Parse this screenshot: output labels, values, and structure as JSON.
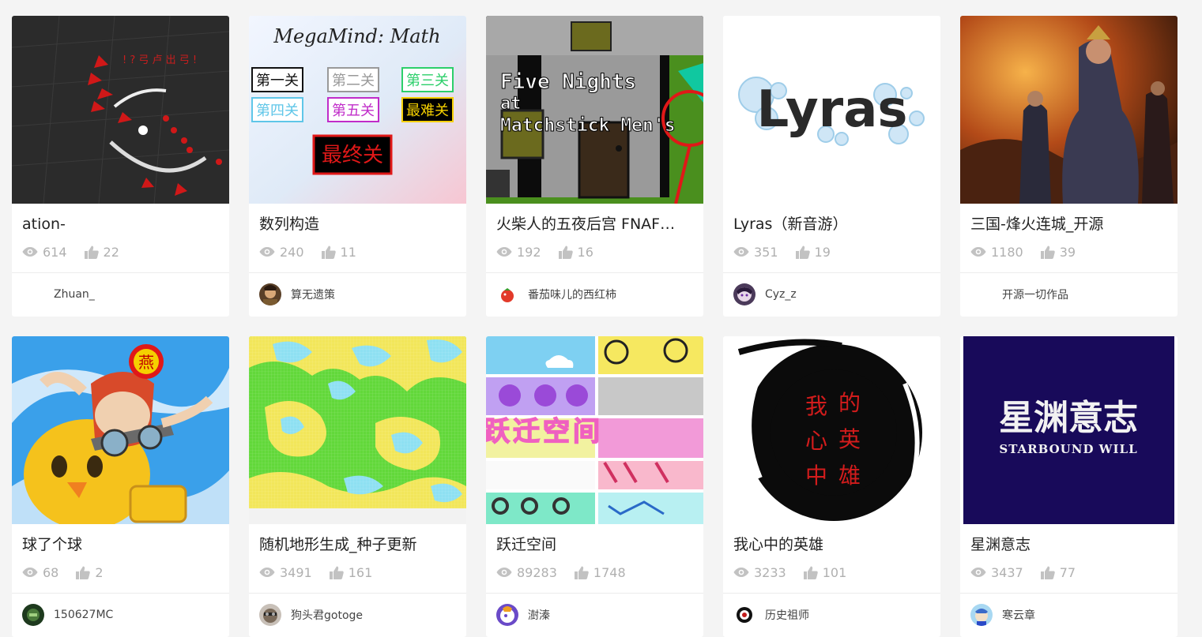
{
  "cards": [
    {
      "title": "ation-",
      "views": "614",
      "likes": "22",
      "author": "Zhuan_",
      "thumb": "dark-arena",
      "avatar": "none"
    },
    {
      "title": "数列构造",
      "views": "240",
      "likes": "11",
      "author": "算无遗策",
      "thumb": "megamind-math",
      "avatar": "warrior",
      "thumb_text": {
        "heading": "MegaMind: Math",
        "levels": [
          "第一关",
          "第二关",
          "第三关",
          "第四关",
          "第五关",
          "最难关"
        ],
        "final": "最终关"
      }
    },
    {
      "title": "火柴人的五夜后宫 FNAF…",
      "views": "192",
      "likes": "16",
      "author": "番茄味儿的西红柿",
      "thumb": "fnaf",
      "avatar": "tomato",
      "thumb_text": {
        "line1": "Five Nights",
        "line2": "at",
        "line3": "Matchstick Men's"
      }
    },
    {
      "title": "Lyras（新音游）",
      "views": "351",
      "likes": "19",
      "author": "Cyz_z",
      "thumb": "lyras",
      "avatar": "anime",
      "thumb_text": {
        "logo": "Lyras"
      }
    },
    {
      "title": "三国-烽火连城_开源",
      "views": "1180",
      "likes": "39",
      "author": "开源一切作品",
      "thumb": "three-kingdoms",
      "avatar": "none"
    },
    {
      "title": "球了个球",
      "views": "68",
      "likes": "2",
      "author": "150627MC",
      "thumb": "ball-hero",
      "avatar": "dark-green",
      "thumb_text": {
        "badge": "燕"
      }
    },
    {
      "title": "随机地形生成_种子更新",
      "views": "3491",
      "likes": "161",
      "author": "狗头君gotoge",
      "thumb": "terrain",
      "avatar": "dog"
    },
    {
      "title": "跃迁空间",
      "views": "89283",
      "likes": "1748",
      "author": "澍溱",
      "thumb": "leap-space",
      "avatar": "purple",
      "thumb_text": {
        "logo": "跃迁空间"
      }
    },
    {
      "title": "我心中的英雄",
      "views": "3233",
      "likes": "101",
      "author": "历史祖师",
      "thumb": "ink-hero",
      "avatar": "ink",
      "thumb_text": {
        "col1": [
          "我",
          "心",
          "中"
        ],
        "col2": [
          "的",
          "英",
          "雄"
        ]
      }
    },
    {
      "title": "星渊意志",
      "views": "3437",
      "likes": "77",
      "author": "寒云章",
      "thumb": "starbound",
      "avatar": "blue-character",
      "thumb_text": {
        "main": "星渊意志",
        "sub": "STARBOUND WILL"
      }
    }
  ],
  "colors": {
    "stat": "#b0b0b0",
    "title": "#222222",
    "author": "#444444"
  }
}
